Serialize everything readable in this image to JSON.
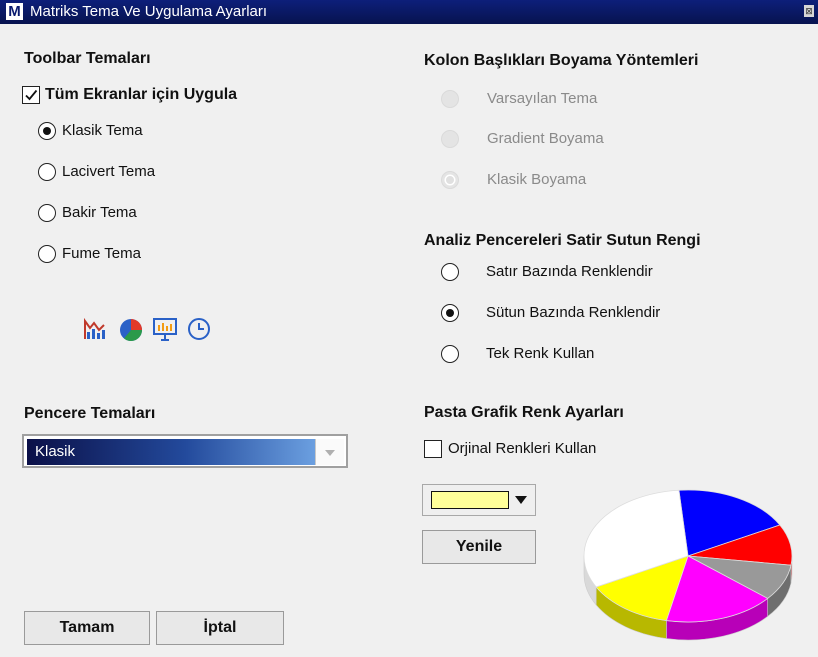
{
  "window": {
    "title": "Matriks Tema Ve Uygulama Ayarları",
    "logo_letter": "M",
    "close_glyph": "⊠"
  },
  "toolbar_themes": {
    "heading": "Toolbar Temaları",
    "apply_all": {
      "label": "Tüm Ekranlar için Uygula",
      "checked": true
    },
    "options": [
      {
        "label": "Klasik Tema",
        "selected": true
      },
      {
        "label": "Lacivert Tema",
        "selected": false
      },
      {
        "label": "Bakir Tema",
        "selected": false
      },
      {
        "label": "Fume Tema",
        "selected": false
      }
    ],
    "preview_icons": [
      "bar-chart-icon",
      "pie-chart-icon",
      "presentation-icon",
      "clock-icon"
    ]
  },
  "column_headers": {
    "heading": "Kolon Başlıkları Boyama Yöntemleri",
    "disabled": true,
    "options": [
      {
        "label": "Varsayılan Tema",
        "selected": false
      },
      {
        "label": "Gradient Boyama",
        "selected": false
      },
      {
        "label": "Klasik Boyama",
        "selected": true
      }
    ]
  },
  "analysis_windows": {
    "heading": "Analiz Pencereleri Satir Sutun Rengi",
    "options": [
      {
        "label": "Satır Bazında Renklendir",
        "selected": false
      },
      {
        "label": "Sütun Bazında Renklendir",
        "selected": true
      },
      {
        "label": "Tek Renk Kullan",
        "selected": false
      }
    ]
  },
  "window_themes": {
    "heading": "Pencere Temaları",
    "selected_value": "Klasik"
  },
  "pie_settings": {
    "heading": "Pasta Grafik Renk Ayarları",
    "original_colors": {
      "label": "Orjinal Renkleri Kullan",
      "checked": false
    },
    "current_color": "#ffff99",
    "refresh_label": "Yenile",
    "preview_colors": [
      "#0000ff",
      "#ff0000",
      "#999999",
      "#ff00ff",
      "#ffff00",
      "#ffffff"
    ]
  },
  "footer": {
    "ok_label": "Tamam",
    "cancel_label": "İptal"
  }
}
